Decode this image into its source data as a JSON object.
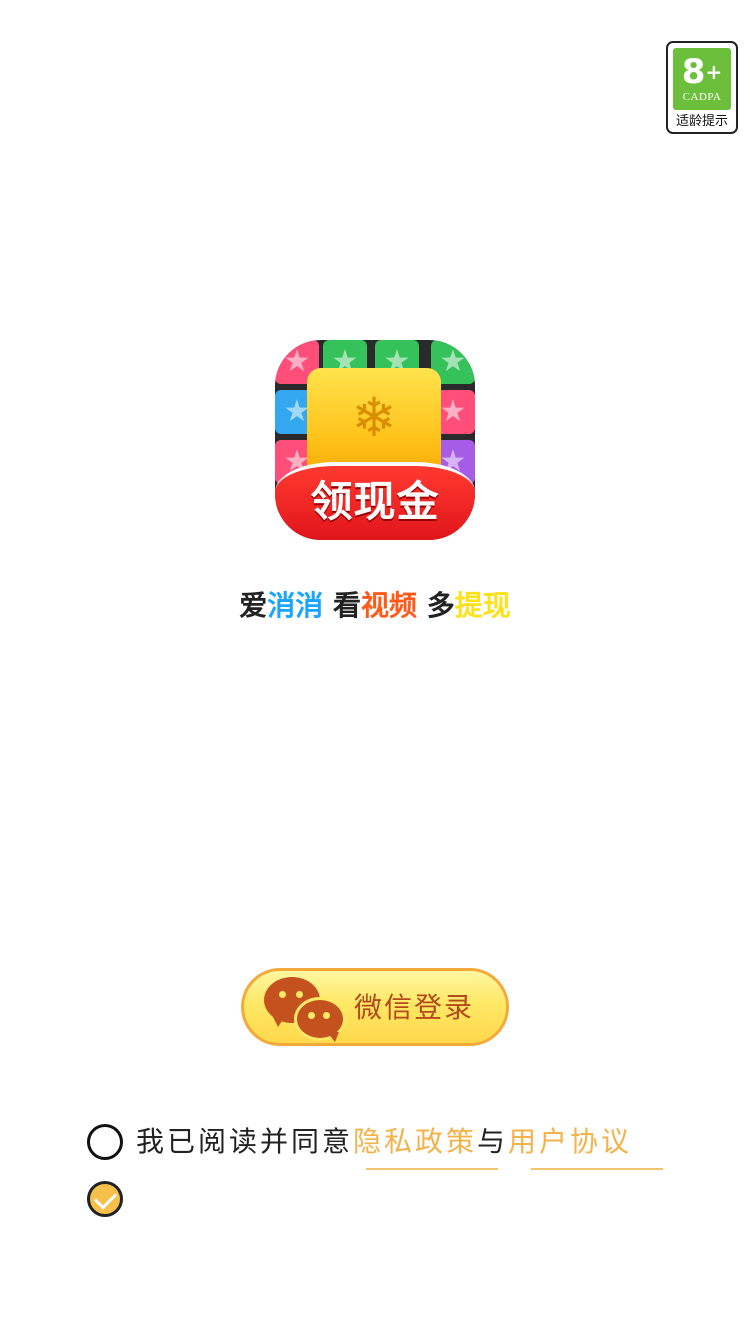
{
  "age_badge": {
    "number": "8",
    "plus": "+",
    "org": "CADPA",
    "tip": "适龄提示"
  },
  "app_icon": {
    "banner_text": "领现金"
  },
  "slogan": {
    "p1": "爱",
    "p2": "消消",
    "p3": " 看",
    "p4": "视频",
    "p5": " 多",
    "p6": "提现"
  },
  "login": {
    "wechat_label": "微信登录"
  },
  "agreement": {
    "prefix": "我已阅读并同意",
    "privacy": "隐私政策",
    "and": "与",
    "terms": "用户协议"
  },
  "colors": {
    "blue": "#1aa6ff",
    "orange": "#ff5a1a",
    "yellow": "#ffe11a",
    "link": "#f3b34a",
    "wechat_text": "#b24a1b"
  }
}
